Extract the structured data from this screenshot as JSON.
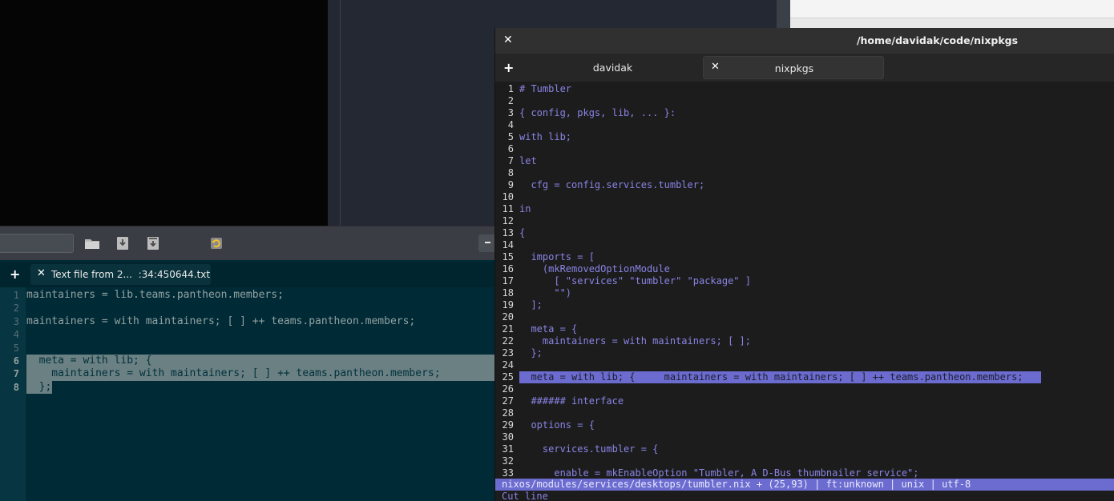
{
  "terminal": {
    "title": "/home/davidak/code/nixpkgs",
    "tabs": [
      {
        "label": "davidak"
      },
      {
        "label": "nixpkgs"
      }
    ],
    "lines": [
      {
        "n": "1",
        "text": "# Tumbler"
      },
      {
        "n": "2",
        "text": ""
      },
      {
        "n": "3",
        "text": "{ config, pkgs, lib, ... }:"
      },
      {
        "n": "4",
        "text": ""
      },
      {
        "n": "5",
        "text": "with lib;"
      },
      {
        "n": "6",
        "text": ""
      },
      {
        "n": "7",
        "text": "let"
      },
      {
        "n": "8",
        "text": ""
      },
      {
        "n": "9",
        "text": "  cfg = config.services.tumbler;"
      },
      {
        "n": "10",
        "text": ""
      },
      {
        "n": "11",
        "text": "in"
      },
      {
        "n": "12",
        "text": ""
      },
      {
        "n": "13",
        "text": "{"
      },
      {
        "n": "14",
        "text": ""
      },
      {
        "n": "15",
        "text": "  imports = ["
      },
      {
        "n": "16",
        "text": "    (mkRemovedOptionModule"
      },
      {
        "n": "17",
        "text": "      [ \"services\" \"tumbler\" \"package\" ]"
      },
      {
        "n": "18",
        "text": "      \"\")"
      },
      {
        "n": "19",
        "text": "  ];"
      },
      {
        "n": "20",
        "text": ""
      },
      {
        "n": "21",
        "text": "  meta = {"
      },
      {
        "n": "22",
        "text": "    maintainers = with maintainers; [ ];"
      },
      {
        "n": "23",
        "text": "  };"
      },
      {
        "n": "24",
        "text": ""
      },
      {
        "n": "25",
        "text": "  meta = with lib; {     maintainers = with maintainers; [ ] ++ teams.pantheon.members;   };"
      },
      {
        "n": "26",
        "text": ""
      },
      {
        "n": "27",
        "text": "  ###### interface"
      },
      {
        "n": "28",
        "text": ""
      },
      {
        "n": "29",
        "text": "  options = {"
      },
      {
        "n": "30",
        "text": ""
      },
      {
        "n": "31",
        "text": "    services.tumbler = {"
      },
      {
        "n": "32",
        "text": ""
      },
      {
        "n": "33",
        "text": "      enable = mkEnableOption \"Tumbler, A D-Bus thumbnailer service\";"
      }
    ],
    "highlight_line": 25,
    "status": "nixos/modules/services/desktops/tumbler.nix + (25,93) | ft:unknown | unix | utf-8",
    "message": "Cut line"
  },
  "text_editor": {
    "tab_label": "Text file from 2...  :34:450644.txt",
    "lines": [
      {
        "n": "1",
        "text": "maintainers = lib.teams.pantheon.members;"
      },
      {
        "n": "2",
        "text": ""
      },
      {
        "n": "3",
        "text": "maintainers = with maintainers; [ ] ++ teams.pantheon.members;"
      },
      {
        "n": "4",
        "text": ""
      },
      {
        "n": "5",
        "text": ""
      },
      {
        "n": "6",
        "text": "  meta = with lib; {"
      },
      {
        "n": "7",
        "text": "    maintainers = with maintainers; [ ] ++ teams.pantheon.members;"
      },
      {
        "n": "8",
        "text": "  };"
      }
    ],
    "selected_lines": [
      6,
      7,
      8
    ]
  },
  "colors": {
    "accent": "#6c6cd0",
    "code_text": "#8a84e6",
    "editor_bg": "#002b36"
  }
}
